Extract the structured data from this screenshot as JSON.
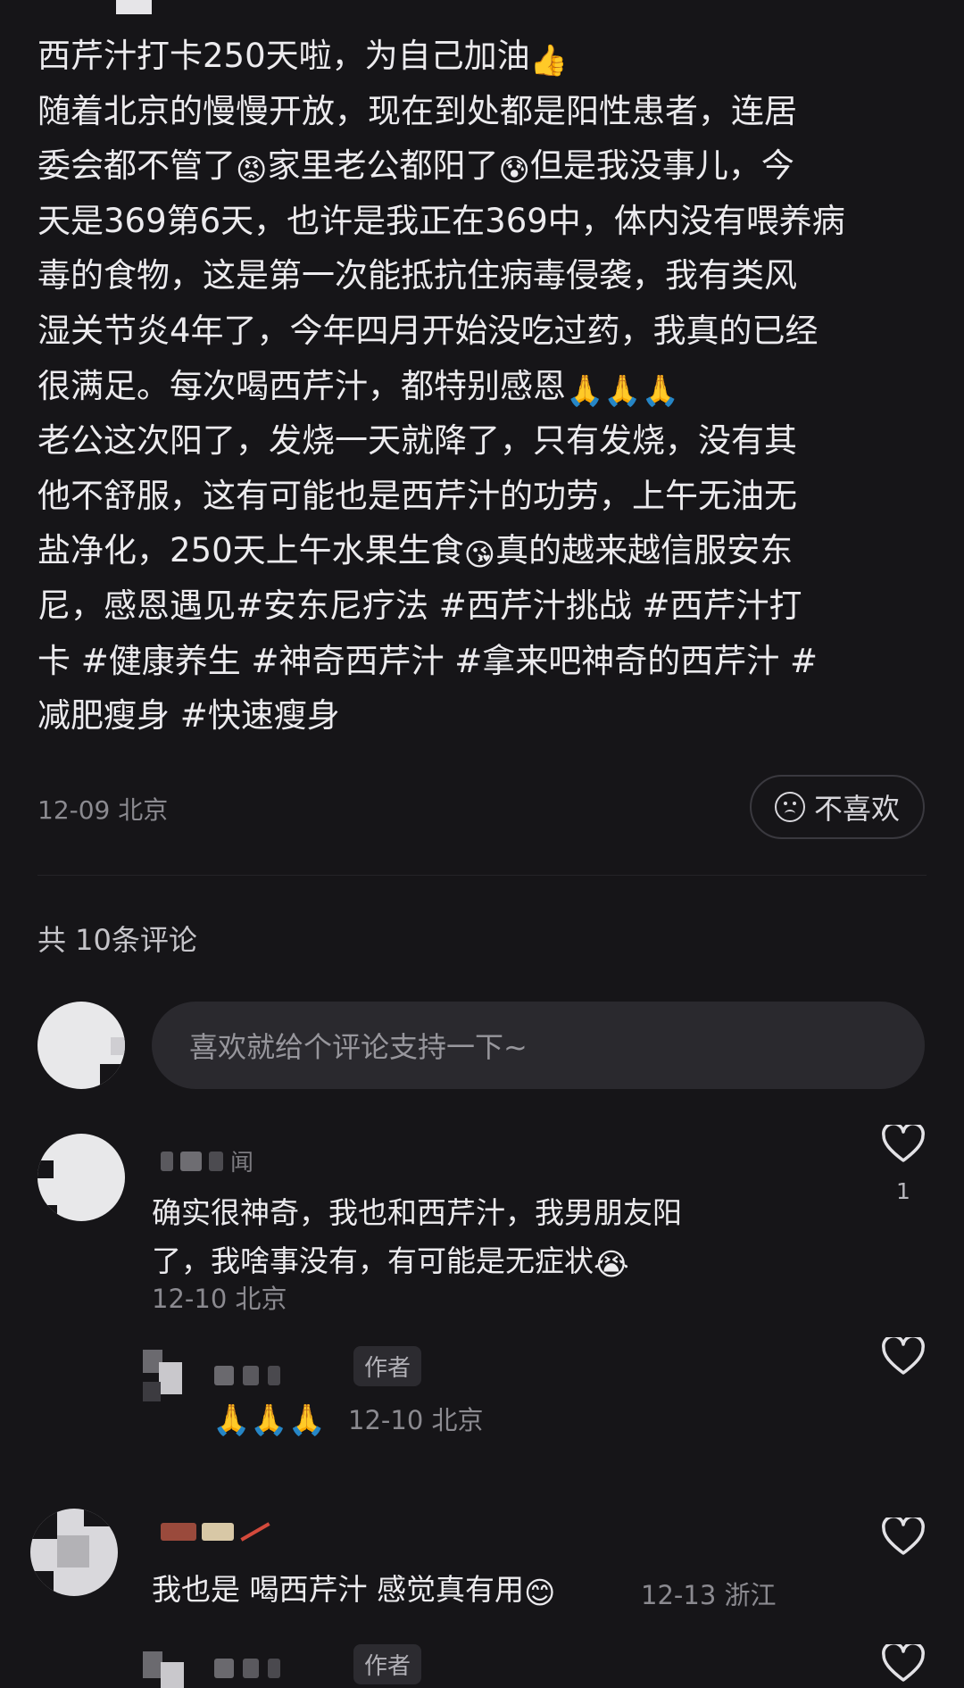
{
  "post": {
    "lines": [
      {
        "text": "西芹汁打卡250天啦，为自己加油",
        "emoji": "👍"
      },
      {
        "text": "随着北京的慢慢开放，现在到处都是阳性患者，连居"
      },
      {
        "text": "委会都不管了",
        "emoji": "😡",
        "text2": "家里老公都阳了",
        "emoji2": "😰",
        "text3": "但是我没事儿，今"
      },
      {
        "text": "天是369第6天，也许是我正在369中，体内没有喂养病"
      },
      {
        "text": "毒的食物，这是第一次能抵抗住病毒侵袭，我有类风"
      },
      {
        "text": "湿关节炎4年了，今年四月开始没吃过药，我真的已经"
      },
      {
        "text": "很满足。每次喝西芹汁，都特别感恩",
        "emoji": "🙏🙏🙏"
      },
      {
        "text": "老公这次阳了，发烧一天就降了，只有发烧，没有其"
      },
      {
        "text": "他不舒服，这有可能也是西芹汁的功劳，上午无油无"
      },
      {
        "text": "盐净化，250天上午水果生食",
        "emoji": "😘",
        "text2": "真的越来越信服安东"
      },
      {
        "text": "尼，感恩遇见#安东尼疗法 #西芹汁挑战 #西芹汁打"
      },
      {
        "text": "卡 #健康养生 #神奇西芹汁 #拿来吧神奇的西芹汁 #"
      },
      {
        "text": "减肥瘦身 #快速瘦身"
      }
    ],
    "date_location": "12-09 北京",
    "dislike_label": "不喜欢"
  },
  "comments_header": "共 10条评论",
  "comment_input": {
    "placeholder": "喜欢就给个评论支持一下~"
  },
  "comments": [
    {
      "username_visible": "闻",
      "text_lines": [
        "确实很神奇，我也和西芹汁，我男朋友阳",
        "了，我啥事没有，有可能是无症状"
      ],
      "text_emoji": "😭",
      "meta": "12-10 北京",
      "likes": "1"
    },
    {
      "author_badge": "作者",
      "emoji_reply": "🙏🙏🙏",
      "meta": "12-10 北京"
    },
    {
      "text": "我也是 喝西芹汁 感觉真有用",
      "text_emoji": "😊",
      "meta": "12-13 浙江"
    },
    {
      "author_badge": "作者"
    }
  ],
  "colors": {
    "background": "#161518",
    "text": "#ecebee",
    "muted": "#8b8a90",
    "input_bg": "#2a292e"
  }
}
